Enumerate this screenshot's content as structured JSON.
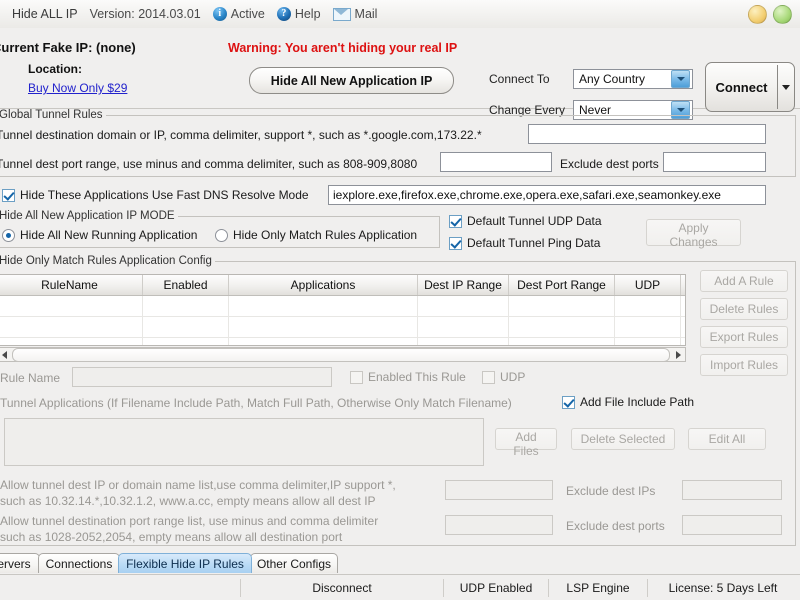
{
  "titlebar": {
    "app_name": "Hide ALL IP",
    "version": "Version: 2014.03.01",
    "active_label": "Active",
    "help_label": "Help",
    "mail_label": "Mail",
    "info_icon_glyph": "i",
    "help_icon_glyph": "?",
    "window_buttons": {
      "minimize_color": "#f3cf72",
      "close_color": "#a8d979"
    }
  },
  "top_panel": {
    "fake_ip_label": "Current Fake IP: (none)",
    "location_label": "Location:",
    "buy_now_link": "Buy Now Only $29",
    "warning_text": "Warning: You aren't hiding your real IP",
    "warning_color": "#dd1111",
    "hide_all_button": "Hide All New Application IP",
    "connect_to_label": "Connect To",
    "connect_to_value": "Any Country",
    "change_every_label": "Change Every",
    "change_every_value": "Never",
    "connect_button": "Connect"
  },
  "global_tunnel_rules": {
    "group_title": "Global Tunnel Rules",
    "dest_domain_label": "Tunnel destination domain or IP, comma delimiter, support *, such as *.google.com,173.22.*",
    "dest_domain_value": "",
    "dest_port_label": "Tunnel dest port range, use minus and comma delimiter, such as 808-909,8080",
    "dest_port_value": "",
    "exclude_dest_ports_label": "Exclude dest ports",
    "exclude_dest_ports_value": ""
  },
  "dns_row": {
    "checkbox_label": "Hide These Applications Use Fast DNS Resolve Mode",
    "checked": true,
    "apps_value": "iexplore.exe,firefox.exe,chrome.exe,opera.exe,safari.exe,seamonkey.exe"
  },
  "ip_mode": {
    "group_title": "Hide All New Application IP MODE",
    "radio_all_label": "Hide All New Running Application",
    "radio_match_label": "Hide Only Match Rules Application",
    "selected": "all",
    "udp_checkbox_label": "Default Tunnel UDP Data",
    "udp_checked": true,
    "ping_checkbox_label": "Default Tunnel Ping Data",
    "ping_checked": true,
    "apply_button": "Apply Changes",
    "apply_enabled": false
  },
  "rules_config": {
    "group_title": "Hide Only Match Rules Application Config",
    "columns": [
      "RuleName",
      "Enabled",
      "Applications",
      "Dest IP Range",
      "Dest Port Range",
      "UDP"
    ],
    "rows": [],
    "empty_row_count": 3,
    "side_buttons": [
      {
        "label": "Add A Rule",
        "enabled": false
      },
      {
        "label": "Delete Rules",
        "enabled": false
      },
      {
        "label": "Export Rules",
        "enabled": false
      },
      {
        "label": "Import Rules",
        "enabled": false
      }
    ],
    "rule_name_label": "Rule Name",
    "rule_name_value": "",
    "enabled_this_rule_label": "Enabled This Rule",
    "enabled_this_rule_checked": false,
    "udp_label": "UDP",
    "udp_checked": false,
    "tunnel_apps_label": "Tunnel Applications (If Filename Include Path, Match Full Path, Otherwise Only Match Filename)",
    "add_file_include_path_label": "Add File Include Path",
    "add_file_include_path_checked": true,
    "file_buttons": [
      {
        "label": "Add Files",
        "enabled": false
      },
      {
        "label": "Delete Selected",
        "enabled": false
      },
      {
        "label": "Edit All",
        "enabled": false
      }
    ],
    "allow_ip_label_line1": "Allow tunnel dest IP or domain name list,use comma delimiter,IP support *,",
    "allow_ip_label_line2": "such as 10.32.14.*,10.32.1.2, www.a.cc, empty means allow all dest IP",
    "allow_ip_value": "",
    "exclude_dest_ips_label": "Exclude dest IPs",
    "exclude_dest_ips_value": "",
    "allow_port_label_line1": "Allow tunnel destination port range list, use minus and comma delimiter",
    "allow_port_label_line2": "such as 1028-2052,2054, empty means allow all destination port",
    "allow_port_value": "",
    "exclude_dest_ports_label": "Exclude dest ports",
    "exclude_dest_ports_value": ""
  },
  "tabs": {
    "items": [
      {
        "label": "Servers",
        "active": false
      },
      {
        "label": "Connections",
        "active": false
      },
      {
        "label": "Flexible Hide IP Rules",
        "active": true
      },
      {
        "label": "Other Configs",
        "active": false
      }
    ],
    "active_color": "#badbf5"
  },
  "statusbar": {
    "connection": "Disconnect",
    "udp": "UDP Enabled",
    "engine": "LSP Engine",
    "license": "License: 5 Days Left"
  }
}
